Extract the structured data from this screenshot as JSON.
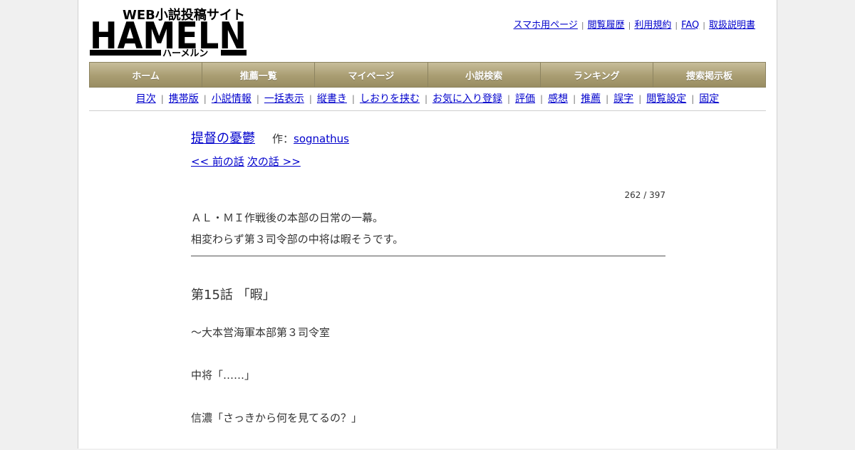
{
  "logo": {
    "tagline": "WEB小説投稿サイト",
    "wordmark": "HAMELN",
    "kana": "ハーメルン"
  },
  "toplinks": [
    "スマホ用ページ",
    "閲覧履歴",
    "利用規約",
    "FAQ",
    "取扱説明書"
  ],
  "mainnav": [
    "ホーム",
    "推薦一覧",
    "マイページ",
    "小説検索",
    "ランキング",
    "捜索掲示板"
  ],
  "subnav": [
    "目次",
    "携帯版",
    "小説情報",
    "一括表示",
    "縦書き",
    "しおりを挟む",
    "お気に入り登録",
    "評価",
    "感想",
    "推薦",
    "誤字",
    "閲覧設定",
    "固定"
  ],
  "novel": {
    "title": "提督の憂鬱",
    "author_prefix": "作：",
    "author": "sognathus",
    "prev": "<< 前の話",
    "next": "次の話 >>",
    "counter": "262 / 397",
    "preface": [
      "ＡＬ・ＭＩ作戦後の本部の日常の一幕。",
      "相変わらず第３司令部の中将は暇そうです。"
    ],
    "chapter_title": "第15話 「暇」",
    "body": [
      "～大本営海軍本部第３司令室",
      "中将「……」",
      "信濃「さっきから何を見てるの？」"
    ]
  },
  "colors": {
    "nav_bg": "#a99d72",
    "link": "#0000cc"
  }
}
